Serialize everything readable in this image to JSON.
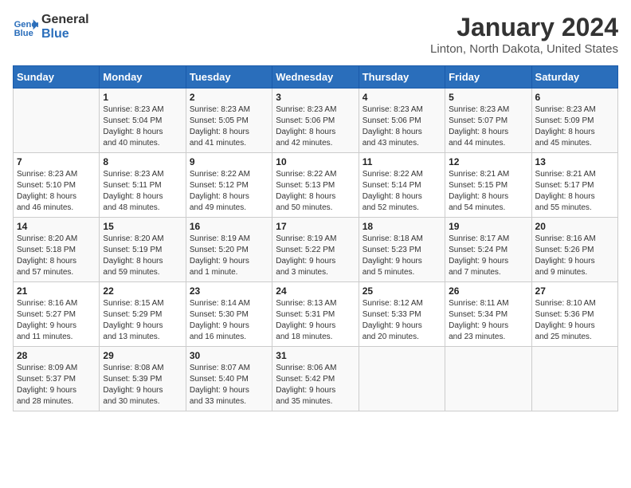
{
  "header": {
    "logo_line1": "General",
    "logo_line2": "Blue",
    "month_year": "January 2024",
    "location": "Linton, North Dakota, United States"
  },
  "days_of_week": [
    "Sunday",
    "Monday",
    "Tuesday",
    "Wednesday",
    "Thursday",
    "Friday",
    "Saturday"
  ],
  "weeks": [
    [
      {
        "day": "",
        "sunrise": "",
        "sunset": "",
        "daylight": ""
      },
      {
        "day": "1",
        "sunrise": "Sunrise: 8:23 AM",
        "sunset": "Sunset: 5:04 PM",
        "daylight": "Daylight: 8 hours and 40 minutes."
      },
      {
        "day": "2",
        "sunrise": "Sunrise: 8:23 AM",
        "sunset": "Sunset: 5:05 PM",
        "daylight": "Daylight: 8 hours and 41 minutes."
      },
      {
        "day": "3",
        "sunrise": "Sunrise: 8:23 AM",
        "sunset": "Sunset: 5:06 PM",
        "daylight": "Daylight: 8 hours and 42 minutes."
      },
      {
        "day": "4",
        "sunrise": "Sunrise: 8:23 AM",
        "sunset": "Sunset: 5:06 PM",
        "daylight": "Daylight: 8 hours and 43 minutes."
      },
      {
        "day": "5",
        "sunrise": "Sunrise: 8:23 AM",
        "sunset": "Sunset: 5:07 PM",
        "daylight": "Daylight: 8 hours and 44 minutes."
      },
      {
        "day": "6",
        "sunrise": "Sunrise: 8:23 AM",
        "sunset": "Sunset: 5:09 PM",
        "daylight": "Daylight: 8 hours and 45 minutes."
      }
    ],
    [
      {
        "day": "7",
        "sunrise": "Sunrise: 8:23 AM",
        "sunset": "Sunset: 5:10 PM",
        "daylight": "Daylight: 8 hours and 46 minutes."
      },
      {
        "day": "8",
        "sunrise": "Sunrise: 8:23 AM",
        "sunset": "Sunset: 5:11 PM",
        "daylight": "Daylight: 8 hours and 48 minutes."
      },
      {
        "day": "9",
        "sunrise": "Sunrise: 8:22 AM",
        "sunset": "Sunset: 5:12 PM",
        "daylight": "Daylight: 8 hours and 49 minutes."
      },
      {
        "day": "10",
        "sunrise": "Sunrise: 8:22 AM",
        "sunset": "Sunset: 5:13 PM",
        "daylight": "Daylight: 8 hours and 50 minutes."
      },
      {
        "day": "11",
        "sunrise": "Sunrise: 8:22 AM",
        "sunset": "Sunset: 5:14 PM",
        "daylight": "Daylight: 8 hours and 52 minutes."
      },
      {
        "day": "12",
        "sunrise": "Sunrise: 8:21 AM",
        "sunset": "Sunset: 5:15 PM",
        "daylight": "Daylight: 8 hours and 54 minutes."
      },
      {
        "day": "13",
        "sunrise": "Sunrise: 8:21 AM",
        "sunset": "Sunset: 5:17 PM",
        "daylight": "Daylight: 8 hours and 55 minutes."
      }
    ],
    [
      {
        "day": "14",
        "sunrise": "Sunrise: 8:20 AM",
        "sunset": "Sunset: 5:18 PM",
        "daylight": "Daylight: 8 hours and 57 minutes."
      },
      {
        "day": "15",
        "sunrise": "Sunrise: 8:20 AM",
        "sunset": "Sunset: 5:19 PM",
        "daylight": "Daylight: 8 hours and 59 minutes."
      },
      {
        "day": "16",
        "sunrise": "Sunrise: 8:19 AM",
        "sunset": "Sunset: 5:20 PM",
        "daylight": "Daylight: 9 hours and 1 minute."
      },
      {
        "day": "17",
        "sunrise": "Sunrise: 8:19 AM",
        "sunset": "Sunset: 5:22 PM",
        "daylight": "Daylight: 9 hours and 3 minutes."
      },
      {
        "day": "18",
        "sunrise": "Sunrise: 8:18 AM",
        "sunset": "Sunset: 5:23 PM",
        "daylight": "Daylight: 9 hours and 5 minutes."
      },
      {
        "day": "19",
        "sunrise": "Sunrise: 8:17 AM",
        "sunset": "Sunset: 5:24 PM",
        "daylight": "Daylight: 9 hours and 7 minutes."
      },
      {
        "day": "20",
        "sunrise": "Sunrise: 8:16 AM",
        "sunset": "Sunset: 5:26 PM",
        "daylight": "Daylight: 9 hours and 9 minutes."
      }
    ],
    [
      {
        "day": "21",
        "sunrise": "Sunrise: 8:16 AM",
        "sunset": "Sunset: 5:27 PM",
        "daylight": "Daylight: 9 hours and 11 minutes."
      },
      {
        "day": "22",
        "sunrise": "Sunrise: 8:15 AM",
        "sunset": "Sunset: 5:29 PM",
        "daylight": "Daylight: 9 hours and 13 minutes."
      },
      {
        "day": "23",
        "sunrise": "Sunrise: 8:14 AM",
        "sunset": "Sunset: 5:30 PM",
        "daylight": "Daylight: 9 hours and 16 minutes."
      },
      {
        "day": "24",
        "sunrise": "Sunrise: 8:13 AM",
        "sunset": "Sunset: 5:31 PM",
        "daylight": "Daylight: 9 hours and 18 minutes."
      },
      {
        "day": "25",
        "sunrise": "Sunrise: 8:12 AM",
        "sunset": "Sunset: 5:33 PM",
        "daylight": "Daylight: 9 hours and 20 minutes."
      },
      {
        "day": "26",
        "sunrise": "Sunrise: 8:11 AM",
        "sunset": "Sunset: 5:34 PM",
        "daylight": "Daylight: 9 hours and 23 minutes."
      },
      {
        "day": "27",
        "sunrise": "Sunrise: 8:10 AM",
        "sunset": "Sunset: 5:36 PM",
        "daylight": "Daylight: 9 hours and 25 minutes."
      }
    ],
    [
      {
        "day": "28",
        "sunrise": "Sunrise: 8:09 AM",
        "sunset": "Sunset: 5:37 PM",
        "daylight": "Daylight: 9 hours and 28 minutes."
      },
      {
        "day": "29",
        "sunrise": "Sunrise: 8:08 AM",
        "sunset": "Sunset: 5:39 PM",
        "daylight": "Daylight: 9 hours and 30 minutes."
      },
      {
        "day": "30",
        "sunrise": "Sunrise: 8:07 AM",
        "sunset": "Sunset: 5:40 PM",
        "daylight": "Daylight: 9 hours and 33 minutes."
      },
      {
        "day": "31",
        "sunrise": "Sunrise: 8:06 AM",
        "sunset": "Sunset: 5:42 PM",
        "daylight": "Daylight: 9 hours and 35 minutes."
      },
      {
        "day": "",
        "sunrise": "",
        "sunset": "",
        "daylight": ""
      },
      {
        "day": "",
        "sunrise": "",
        "sunset": "",
        "daylight": ""
      },
      {
        "day": "",
        "sunrise": "",
        "sunset": "",
        "daylight": ""
      }
    ]
  ]
}
